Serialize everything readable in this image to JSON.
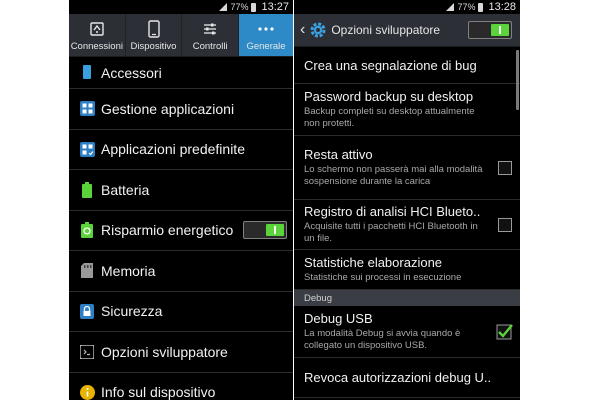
{
  "left": {
    "status": {
      "battery": "77%",
      "time": "13:27"
    },
    "tabs": [
      {
        "label": "Connessioni",
        "icon": "connections-icon"
      },
      {
        "label": "Dispositivo",
        "icon": "phone-icon"
      },
      {
        "label": "Controlli",
        "icon": "sliders-icon"
      },
      {
        "label": "Generale",
        "icon": "more-dots-icon",
        "active": true
      }
    ],
    "items": [
      {
        "label": "Accessori",
        "icon": "accessories-icon"
      },
      {
        "label": "Gestione applicazioni",
        "icon": "apps-grid-icon"
      },
      {
        "label": "Applicazioni predefinite",
        "icon": "default-apps-icon"
      },
      {
        "label": "Batteria",
        "icon": "battery-icon"
      },
      {
        "label": "Risparmio energetico",
        "icon": "power-saving-icon",
        "toggle": true
      },
      {
        "label": "Memoria",
        "icon": "memory-icon"
      },
      {
        "label": "Sicurezza",
        "icon": "lock-icon"
      },
      {
        "label": "Opzioni sviluppatore",
        "icon": "developer-icon"
      },
      {
        "label": "Info sul dispositivo",
        "icon": "info-icon"
      }
    ]
  },
  "right": {
    "status": {
      "battery": "77%",
      "time": "13:28"
    },
    "header": {
      "title": "Opzioni sviluppatore",
      "toggle_on": true
    },
    "items": [
      {
        "title": "Crea una segnalazione di bug",
        "subtitle": ""
      },
      {
        "title": "Password backup su desktop",
        "subtitle": "Backup completi su desktop attualmente non protetti."
      },
      {
        "title": "Resta attivo",
        "subtitle": "Lo schermo non passerà mai alla modalità sospensione durante la carica",
        "checkbox": false
      },
      {
        "title": "Registro di analisi HCI Blueto..",
        "subtitle": "Acquisite tutti i pacchetti HCI Bluetooth in un file.",
        "checkbox": false
      },
      {
        "title": "Statistiche elaborazione",
        "subtitle": "Statistiche sui processi in esecuzione"
      }
    ],
    "section": "Debug",
    "debug_items": [
      {
        "title": "Debug USB",
        "subtitle": "La modalità Debug si avvia quando è collegato un dispositivo USB.",
        "checkbox": true
      },
      {
        "title": "Revoca autorizzazioni debug U..",
        "subtitle": ""
      }
    ]
  },
  "colors": {
    "accent_blue": "#2d8ac6",
    "toggle_green": "#5bd33a",
    "header_bg": "#2c3036"
  }
}
